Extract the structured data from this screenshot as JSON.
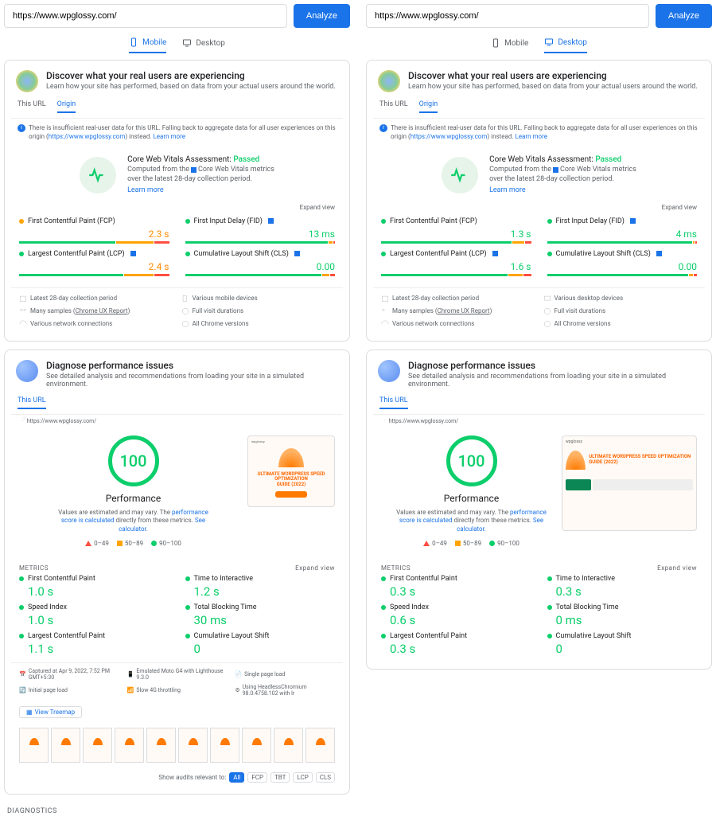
{
  "url": "https://www.wpglossy.com/",
  "analyze": "Analyze",
  "devtabs": {
    "mobile": "Mobile",
    "desktop": "Desktop"
  },
  "discover": {
    "title": "Discover what your real users are experiencing",
    "sub": "Learn how your site has performed, based on data from your actual users around the world."
  },
  "subtabs": {
    "this_url": "This URL",
    "origin": "Origin"
  },
  "note": {
    "pre": "There is insufficient real-user data for this URL. Falling back to aggregate data for all user experiences on this origin (",
    "link": "https://www.wpglossy.com",
    "post": ") instead.",
    "learn": "Learn more"
  },
  "cwv": {
    "title_pre": "Core Web Vitals Assessment:",
    "pass": "Passed",
    "det_pre": "Computed from the",
    "det_mid": "Core Web Vitals metrics",
    "det_end": "over the latest 28-day collection period.",
    "learn": "Learn more"
  },
  "expand": "Expand view",
  "field_metrics": {
    "fcp": "First Contentful Paint (FCP)",
    "fid": "First Input Delay (FID)",
    "lcp": "Largest Contentful Paint (LCP)",
    "cls": "Cumulative Layout Shift (CLS)"
  },
  "mobile_field": {
    "fcp": "2.3 s",
    "fid": "13 ms",
    "lcp": "2.4 s",
    "cls": "0.00"
  },
  "desktop_field": {
    "fcp": "1.3 s",
    "fid": "4 ms",
    "lcp": "1.6 s",
    "cls": "0.00"
  },
  "meta": {
    "period": "Latest 28-day collection period",
    "devices_mobile": "Various mobile devices",
    "devices_desktop": "Various desktop devices",
    "samples_pre": "Many samples",
    "samples_link": "Chrome UX Report",
    "visit": "Full visit durations",
    "network": "Various network connections",
    "chrome": "All Chrome versions"
  },
  "diag": {
    "title": "Diagnose performance issues",
    "sub": "See detailed analysis and recommendations from loading your site in a simulated environment."
  },
  "score_mobile": "100",
  "score_desktop": "100",
  "perf_label": "Performance",
  "perf_note_pre": "Values are estimated and may vary. The",
  "perf_note_link": "performance score is calculated",
  "perf_note_mid": "directly from these metrics.",
  "perf_note_calc": "See calculator.",
  "legend": {
    "bad": "0–49",
    "avg": "50–89",
    "good": "90–100"
  },
  "shot": {
    "title": "ULTIMATE WORDPRESS SPEED OPTIMIZATION",
    "guide": "GUIDE (2022)"
  },
  "sec_metrics": "METRICS",
  "lab": {
    "fcp": "First Contentful Paint",
    "tti": "Time to Interactive",
    "si": "Speed Index",
    "tbt": "Total Blocking Time",
    "lcp": "Largest Contentful Paint",
    "cls": "Cumulative Layout Shift"
  },
  "lab_mobile": {
    "fcp": "1.0 s",
    "tti": "1.2 s",
    "si": "1.0 s",
    "tbt": "30 ms",
    "lcp": "1.1 s",
    "cls": "0"
  },
  "lab_desktop": {
    "fcp": "0.3 s",
    "tti": "0.3 s",
    "si": "0.6 s",
    "tbt": "0 ms",
    "lcp": "0.3 s",
    "cls": "0"
  },
  "cap": {
    "at": "Captured at Apr 9, 2022, 7:52 PM GMT+5:30",
    "dev": "Emulated Moto G4 with Lighthouse 9.3.0",
    "single": "Single page load",
    "init": "Initial page load",
    "net": "Slow 4G throttling",
    "hc": "Using HeadlessChromium 98.0.4758.102 with lr"
  },
  "treemap": "View Treemap",
  "audits": {
    "label": "Show audits relevant to:",
    "all": "All",
    "fcp": "FCP",
    "tbt": "TBT",
    "lcp": "LCP",
    "cls": "CLS"
  },
  "diagnostics": "DIAGNOSTICS"
}
